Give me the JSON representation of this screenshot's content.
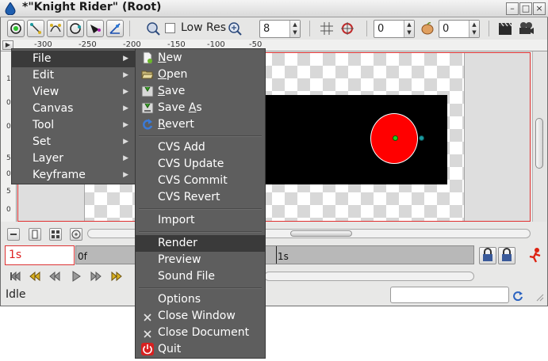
{
  "window": {
    "title": "*\"Knight Rider\" (Root)",
    "controls": [
      "–",
      "□",
      "×"
    ]
  },
  "toolbar": {
    "low_res_label": "Low Res",
    "zoom_value": "8",
    "grid_spin_value": "0",
    "onion_spin_value": "0"
  },
  "ruler": {
    "h_ticks": [
      "-300",
      "-250",
      "-200",
      "-150",
      "-100",
      "-50"
    ],
    "v_ticks": [
      "1",
      "0",
      "0",
      "5",
      "0",
      "5",
      "0"
    ]
  },
  "timebar": {
    "current_time": "1s",
    "start_label": "0f",
    "mid_label": "1s"
  },
  "status": {
    "text": "Idle"
  },
  "main_menu": {
    "items": [
      {
        "label": "File",
        "has_submenu": true,
        "highlighted": true
      },
      {
        "label": "Edit",
        "has_submenu": true
      },
      {
        "label": "View",
        "has_submenu": true
      },
      {
        "label": "Canvas",
        "has_submenu": true
      },
      {
        "label": "Tool",
        "has_submenu": true
      },
      {
        "label": "Set",
        "has_submenu": true
      },
      {
        "label": "Layer",
        "has_submenu": true
      },
      {
        "label": "Keyframe",
        "has_submenu": true
      }
    ]
  },
  "file_menu": {
    "items": [
      {
        "label": "New",
        "icon": "new-file-icon",
        "mnemonic": "N"
      },
      {
        "label": "Open",
        "icon": "folder-open-icon",
        "mnemonic": "O"
      },
      {
        "label": "Save",
        "icon": "save-icon",
        "mnemonic": "S"
      },
      {
        "label": "Save As",
        "icon": "save-as-icon",
        "mnemonic": "A"
      },
      {
        "label": "Revert",
        "icon": "revert-icon",
        "mnemonic": "R"
      },
      {
        "label": "CVS Add"
      },
      {
        "label": "CVS Update"
      },
      {
        "label": "CVS Commit"
      },
      {
        "label": "CVS Revert"
      },
      {
        "label": "Import"
      },
      {
        "label": "Render",
        "highlighted": true
      },
      {
        "label": "Preview"
      },
      {
        "label": "Sound File"
      },
      {
        "label": "Options"
      },
      {
        "label": "Close Window",
        "icon": "close-x-icon"
      },
      {
        "label": "Close Document",
        "icon": "close-x-icon"
      },
      {
        "label": "Quit",
        "icon": "quit-power-icon"
      }
    ]
  },
  "colors": {
    "menu_bg": "#5e5e5e",
    "menu_highlight": "#3a3a3a",
    "circle_fill": "#ff0000",
    "handle_green": "#22cc22",
    "handle_teal": "#1a9aa0",
    "canvas_border": "#e03030"
  }
}
